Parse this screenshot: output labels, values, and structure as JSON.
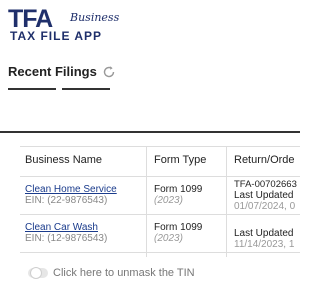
{
  "logo": {
    "brand": "TFA",
    "business": "Business",
    "app_name": "TAX FILE APP"
  },
  "section": {
    "title": "Recent Filings",
    "refresh_icon": "refresh-icon"
  },
  "table": {
    "headers": [
      "Business Name",
      "Form Type",
      "Return/Orde"
    ],
    "rows": [
      {
        "business_name": "Clean Home Service",
        "ein": "EIN: (22-9876543)",
        "form_type": "Form 1099",
        "form_year": "(2023)",
        "return_id": "TFA-00702663",
        "updated_label": "Last Updated",
        "updated_date": "01/07/2024, 0"
      },
      {
        "business_name": "Clean Car Wash",
        "ein": "EIN: (12-9876543)",
        "form_type": "Form 1099",
        "form_year": "(2023)",
        "return_id": "",
        "updated_label": "Last Updated",
        "updated_date": "11/14/2023, 1"
      }
    ]
  },
  "tin_toggle": {
    "label": "Click here to unmask the TIN",
    "on": false
  },
  "colors": {
    "brand_navy": "#1f2f6b",
    "link": "#1a3b8c"
  }
}
